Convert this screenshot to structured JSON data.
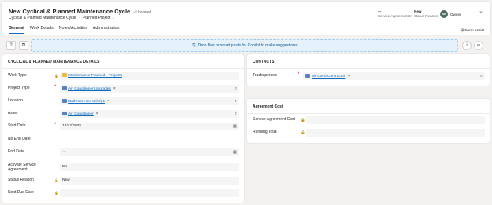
{
  "header": {
    "title": "New Cyclical & Planned Maintenance Cycle",
    "unsaved": "- Unsaved",
    "entity": "Cyclical & Planned Maintenance Cycle",
    "form": "Planned Project",
    "fields": [
      {
        "value": "---",
        "label": "Service Agreement In"
      },
      {
        "value": "New",
        "label": "Status Reason"
      }
    ],
    "owner": {
      "initials": "AB",
      "label": "Owner"
    }
  },
  "tabs": [
    "General",
    "Work Details",
    "Notes/Activities",
    "Administration"
  ],
  "toolbar": {
    "dropzone": "Drop files or smart paste for Copilot to make suggestions",
    "form_assist": "Form assist"
  },
  "left_section": {
    "title": "CYCLICAL & PLANNED MAINTENANCE DETAILS",
    "work_type": {
      "label": "Work Type",
      "value": "Maintenance Planned - Projects"
    },
    "project_type": {
      "label": "Project Type",
      "value": "Air Conditioner Upgrades"
    },
    "location": {
      "label": "Location",
      "value": "Bathroom (no toilet) 1"
    },
    "asset": {
      "label": "Asset",
      "value": "Air Conditioner"
    },
    "start_date": {
      "label": "Start Date",
      "value": "14/12/2025"
    },
    "no_end_date": {
      "label": "No End Date"
    },
    "end_date": {
      "label": "End Date",
      "value": "---"
    },
    "activate_service": {
      "label_line1": "Activate Service",
      "label_line2": "Agreement",
      "value": "No"
    },
    "status_reason": {
      "label": "Status Reason",
      "value": "New"
    },
    "next_due_date": {
      "label": "Next Due Date",
      "value": ""
    }
  },
  "contacts": {
    "title": "CONTACTS",
    "tradesperson": {
      "label": "Tradesperson",
      "value": "Air Cond Contractor"
    }
  },
  "agreement_cost": {
    "title": "Agreement Cost",
    "service_agreement_cost": {
      "label": "Service Agreement Cost",
      "value": ""
    },
    "running_total": {
      "label": "Running Total",
      "value": ""
    }
  },
  "colors": {
    "accent": "#0f6cbd",
    "required": "#c50f1f",
    "dropzone_bg": "#e6f2fb"
  }
}
